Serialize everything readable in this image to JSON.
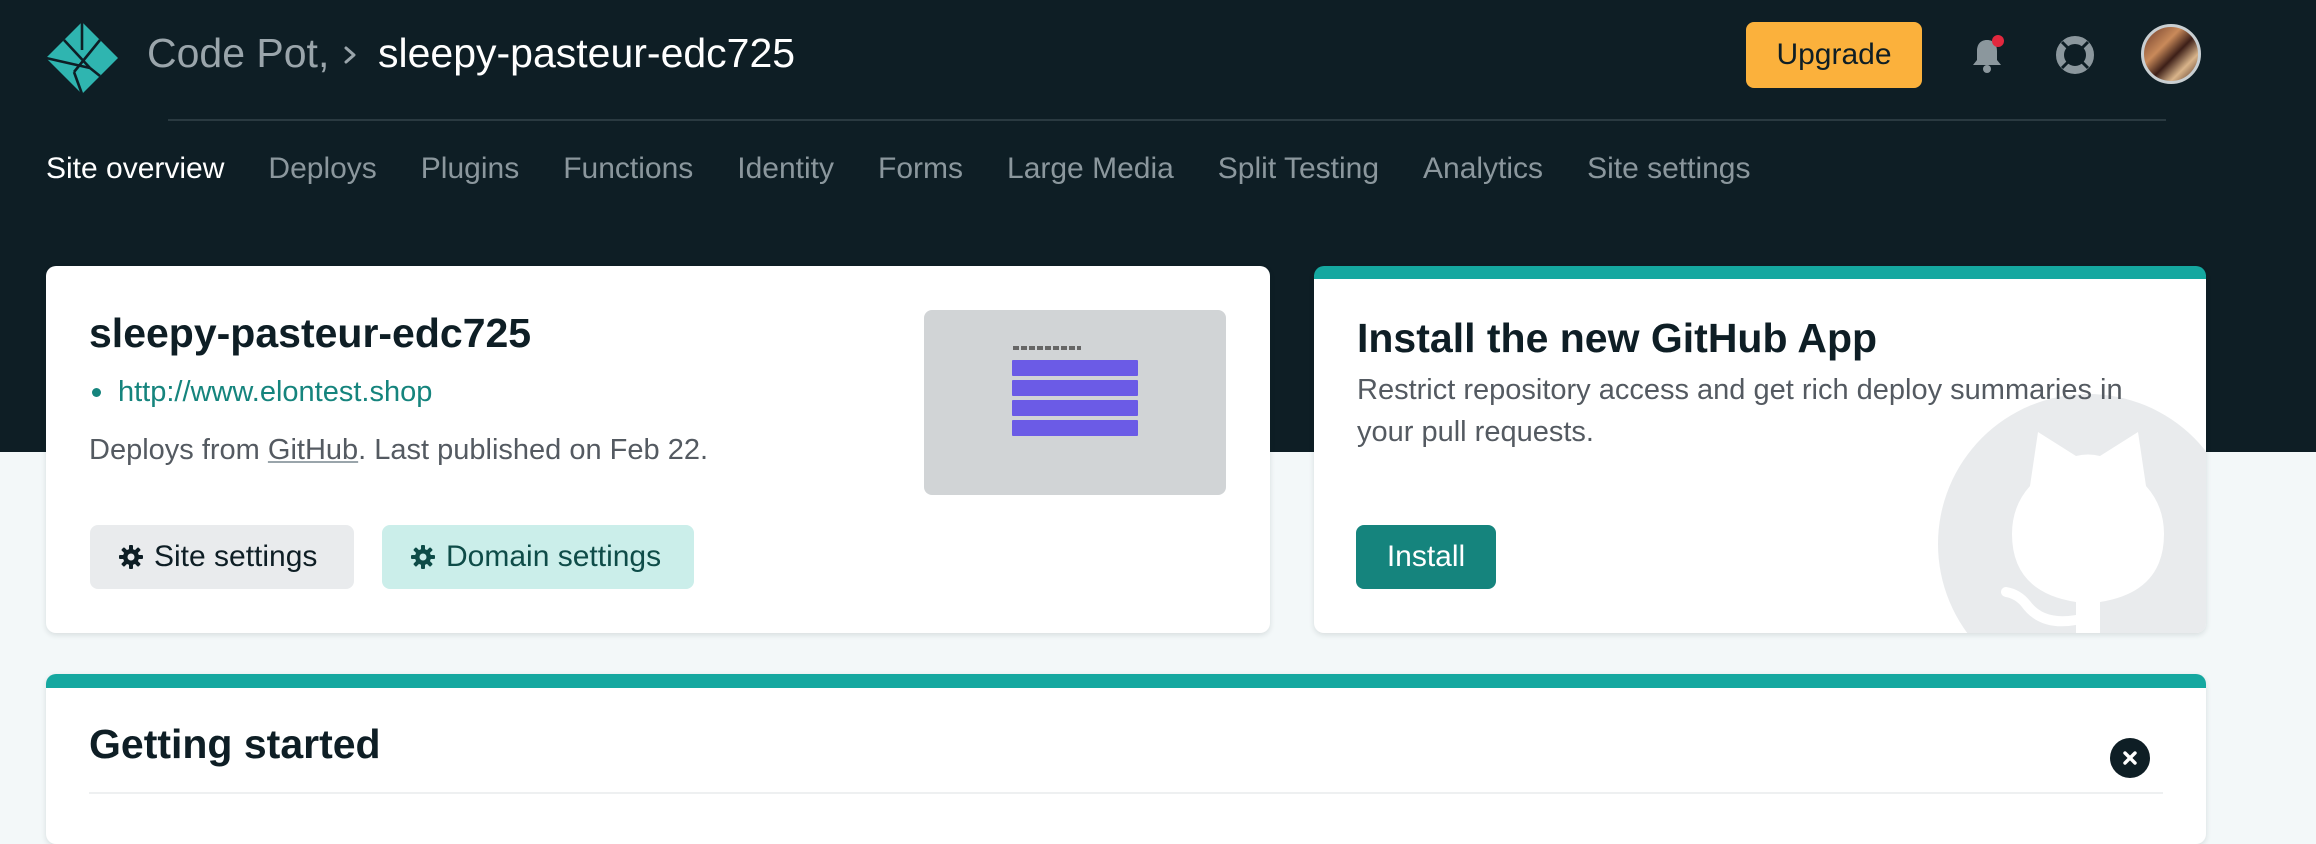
{
  "header": {
    "logo_icon": "netlify-logo-icon",
    "team": "Code Pot,",
    "separator_icon": "chevron-right-icon",
    "site": "sleepy-pasteur-edc725",
    "upgrade_label": "Upgrade",
    "notification_icon": "bell-icon",
    "help_icon": "lifebuoy-icon",
    "avatar_icon": "user-avatar"
  },
  "nav": {
    "items": [
      {
        "label": "Site overview",
        "active": true
      },
      {
        "label": "Deploys"
      },
      {
        "label": "Plugins"
      },
      {
        "label": "Functions"
      },
      {
        "label": "Identity"
      },
      {
        "label": "Forms"
      },
      {
        "label": "Large Media"
      },
      {
        "label": "Split Testing"
      },
      {
        "label": "Analytics"
      },
      {
        "label": "Site settings"
      }
    ]
  },
  "site_card": {
    "name": "sleepy-pasteur-edc725",
    "url": "http://www.elontest.shop",
    "deploy_prefix": "Deploys from ",
    "deploy_provider": "GitHub",
    "deploy_suffix": ". Last published on Feb 22.",
    "site_settings_label": "Site settings",
    "domain_settings_label": "Domain settings",
    "settings_icon": "gear-icon",
    "preview_icon": "site-preview-thumbnail"
  },
  "github_card": {
    "title": "Install the new GitHub App",
    "description": "Restrict repository access and get rich deploy summaries in your pull requests.",
    "install_label": "Install",
    "decoration_icon": "github-octocat-icon"
  },
  "getting_started": {
    "title": "Getting started",
    "close_icon": "close-icon"
  },
  "colors": {
    "header_bg": "#0e1e25",
    "page_bg": "#f3f8f9",
    "accent_teal": "#15a8a0",
    "link_teal": "#15847d",
    "upgrade_yellow": "#fbb13c",
    "notification_red": "#e2283e"
  }
}
